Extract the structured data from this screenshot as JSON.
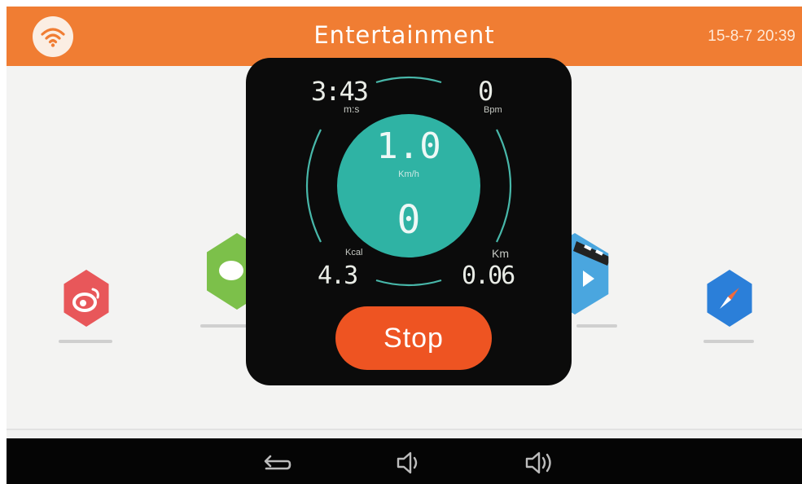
{
  "header": {
    "title": "Entertainment",
    "datetime": "15-8-7 20:39",
    "wifi_icon": "wifi-icon",
    "color": "#f07d33"
  },
  "overlay": {
    "time": {
      "value": "3:43",
      "unit": "m:s"
    },
    "heart_rate": {
      "value": "0",
      "unit": "Bpm"
    },
    "speed": {
      "value": "1.0",
      "unit": "Km/h"
    },
    "count": {
      "value": "0"
    },
    "calories": {
      "value": "4.3",
      "unit": "Kcal"
    },
    "distance": {
      "value": "0.06",
      "unit": "Km"
    },
    "stop_label": "Stop",
    "gauge_color": "#2fb3a4",
    "stop_color": "#ee5422"
  },
  "apps": [
    {
      "icon": "weibo-icon",
      "color": "#e8575a"
    },
    {
      "icon": "wechat-icon",
      "color": "#7cc04a"
    },
    {
      "icon": "video-icon",
      "color": "#4aa6df"
    },
    {
      "icon": "compass-icon",
      "color": "#2b7fd9"
    }
  ],
  "navbar": {
    "back_icon": "back-icon",
    "volume_down_icon": "volume-down-icon",
    "volume_up_icon": "volume-up-icon"
  }
}
